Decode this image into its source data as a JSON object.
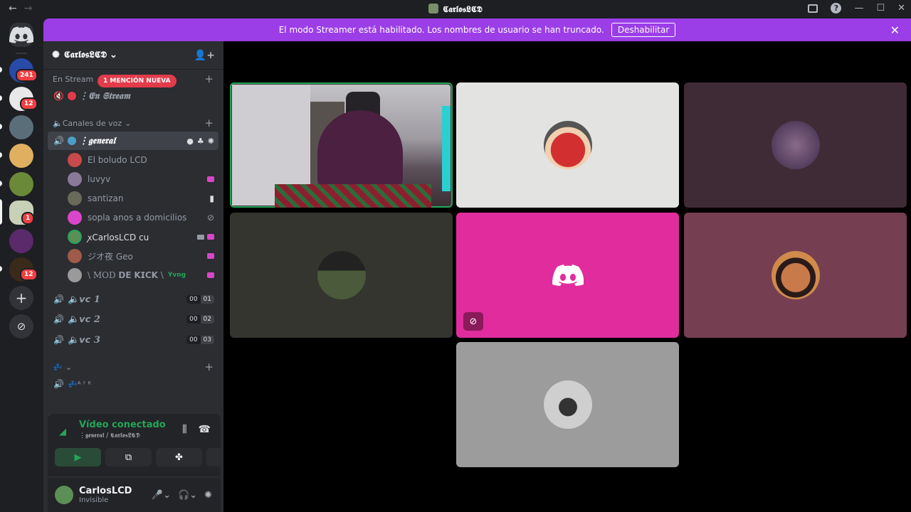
{
  "window": {
    "title": "𝕮𝖆𝖗𝖑𝖔𝖘𝕷𝕮𝕯",
    "nav_back": "←",
    "nav_forward": "→",
    "controls": [
      "—",
      "☐",
      "✕"
    ]
  },
  "banner": {
    "text": "El modo Streamer está habilitado. Los nombres de usuario se han truncado.",
    "button": "Deshabilitar",
    "close": "✕"
  },
  "guilds": [
    {
      "name": "server-1",
      "color": "#2a4aa8",
      "badge": "241"
    },
    {
      "name": "server-2",
      "color": "#e8e8e8",
      "badge": "12"
    },
    {
      "name": "server-3",
      "color": "#5a6e7a",
      "badge": ""
    },
    {
      "name": "server-4",
      "color": "#e0b060",
      "badge": ""
    },
    {
      "name": "server-5",
      "color": "#6a8a3a",
      "badge": ""
    },
    {
      "name": "server-6",
      "color": "#c8d0b8",
      "badge": "1"
    },
    {
      "name": "server-7",
      "color": "#5a2a6a",
      "badge": ""
    },
    {
      "name": "server-8",
      "color": "#3a2a1a",
      "badge": "12"
    }
  ],
  "server": {
    "name": "𝕮𝖆𝖗𝖑𝖔𝖘𝕷𝕮𝕯",
    "chevron": "⌄"
  },
  "categories": {
    "stream": {
      "label": "En Stream",
      "chevron": "⌄"
    },
    "voice": {
      "label": "🔈Canales de voz",
      "chevron": "⌄"
    },
    "afk": {
      "label": "💤",
      "chevron": "⌄"
    }
  },
  "mention_pill": "1 MENCIÓN NUEVA",
  "channels": {
    "en_stream": "⋮𝕰𝖓 𝕾𝖙𝖗𝖊𝖆𝖒",
    "general": "⋮𝖌𝖊𝖓𝖊𝖗𝖆𝖑",
    "vc1": {
      "label": "🔈𝙫𝙘 1",
      "count": [
        "00",
        "01"
      ]
    },
    "vc2": {
      "label": "🔈𝙫𝙘 2",
      "count": [
        "00",
        "02"
      ]
    },
    "vc3": {
      "label": "🔈𝙫𝙘 3",
      "count": [
        "00",
        "03"
      ]
    },
    "afk": "💤ᴬ ᶠ ᴷ"
  },
  "voice_users": [
    {
      "name": "El boludo LCD",
      "color": "#c84a4a"
    },
    {
      "name": "luvyv",
      "color": "#8a7a9a"
    },
    {
      "name": "santizan",
      "color": "#6a6a5a"
    },
    {
      "name": "sopla anos a domicilios",
      "color": "#d946c9"
    },
    {
      "name": "ꭗCarlosLCD cu",
      "color": "#5c8f55"
    },
    {
      "name": "ジオ夜 Geo",
      "color": "#a05a4a"
    },
    {
      "name": "\\ MOD 𝗗𝗘 𝗞𝗜𝗖𝗞 \\",
      "color": "#9a9a9a",
      "tag": "Yvng"
    }
  ],
  "voice_panel": {
    "status": "Vídeo conectado",
    "channel": "⋮𝖌𝖊𝖓𝖊𝖗𝖆𝖑 / 𝕮𝖆𝖗𝖑𝖔𝖘𝕷𝕮𝕯"
  },
  "user": {
    "name": "CarlosLCD",
    "status": "Invisible"
  },
  "tiles": [
    {
      "name": "tile-camera",
      "bg": "#3a3a3a"
    },
    {
      "name": "tile-user-2",
      "bg": "#e3e3e1",
      "avatar": "#d23030"
    },
    {
      "name": "tile-user-3",
      "bg": "#3f2b35",
      "avatar": "#6a5a7a"
    },
    {
      "name": "tile-user-4",
      "bg": "#34352f",
      "avatar": "#4a5a3a"
    },
    {
      "name": "tile-user-5",
      "bg": "#e02c9c"
    },
    {
      "name": "tile-user-6",
      "bg": "#763e51",
      "avatar": "#c87a4a"
    },
    {
      "name": "tile-user-7",
      "bg": "#9c9c9c",
      "avatar": "#cfcfcf"
    }
  ]
}
